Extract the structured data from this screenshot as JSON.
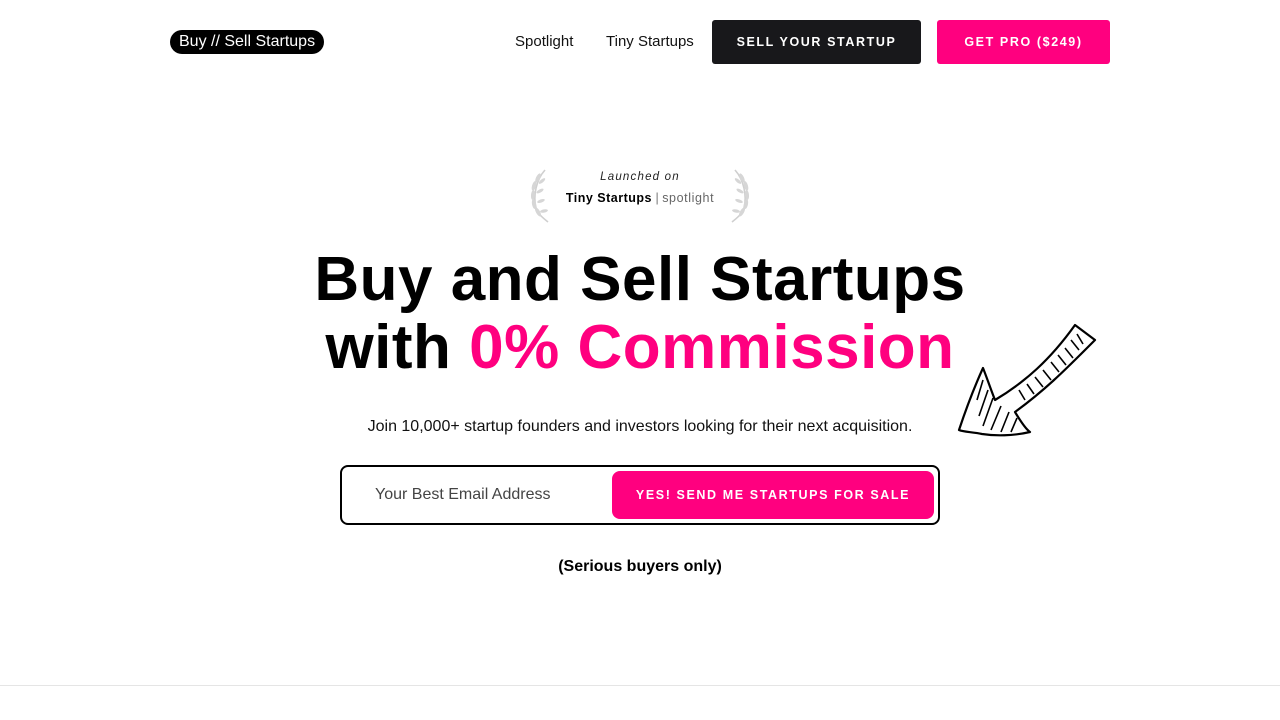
{
  "header": {
    "logo": "Buy // Sell Startups",
    "nav": [
      {
        "label": "Spotlight"
      },
      {
        "label": "Tiny Startups"
      }
    ],
    "sell_button": "SELL YOUR STARTUP",
    "pro_button": "GET PRO ($249)"
  },
  "badge": {
    "launched": "Launched on",
    "brand": "Tiny Startups",
    "separator": "|",
    "product": "spotlight"
  },
  "hero": {
    "title_line1": "Buy and Sell Startups",
    "title_line2_prefix": "with ",
    "title_line2_accent": "0% Commission",
    "subtitle": "Join 10,000+ startup founders and investors looking for their next acquisition."
  },
  "form": {
    "email_placeholder": "Your Best Email Address",
    "email_value": "",
    "submit_label": "YES! SEND ME STARTUPS FOR SALE"
  },
  "note": "(Serious buyers only)",
  "colors": {
    "accent": "#ff007f",
    "dark_button": "#18181b"
  },
  "icons": {
    "badge_laurels": "laurel-wreath-icon",
    "hero_arrow": "hand-drawn-arrow-icon"
  }
}
